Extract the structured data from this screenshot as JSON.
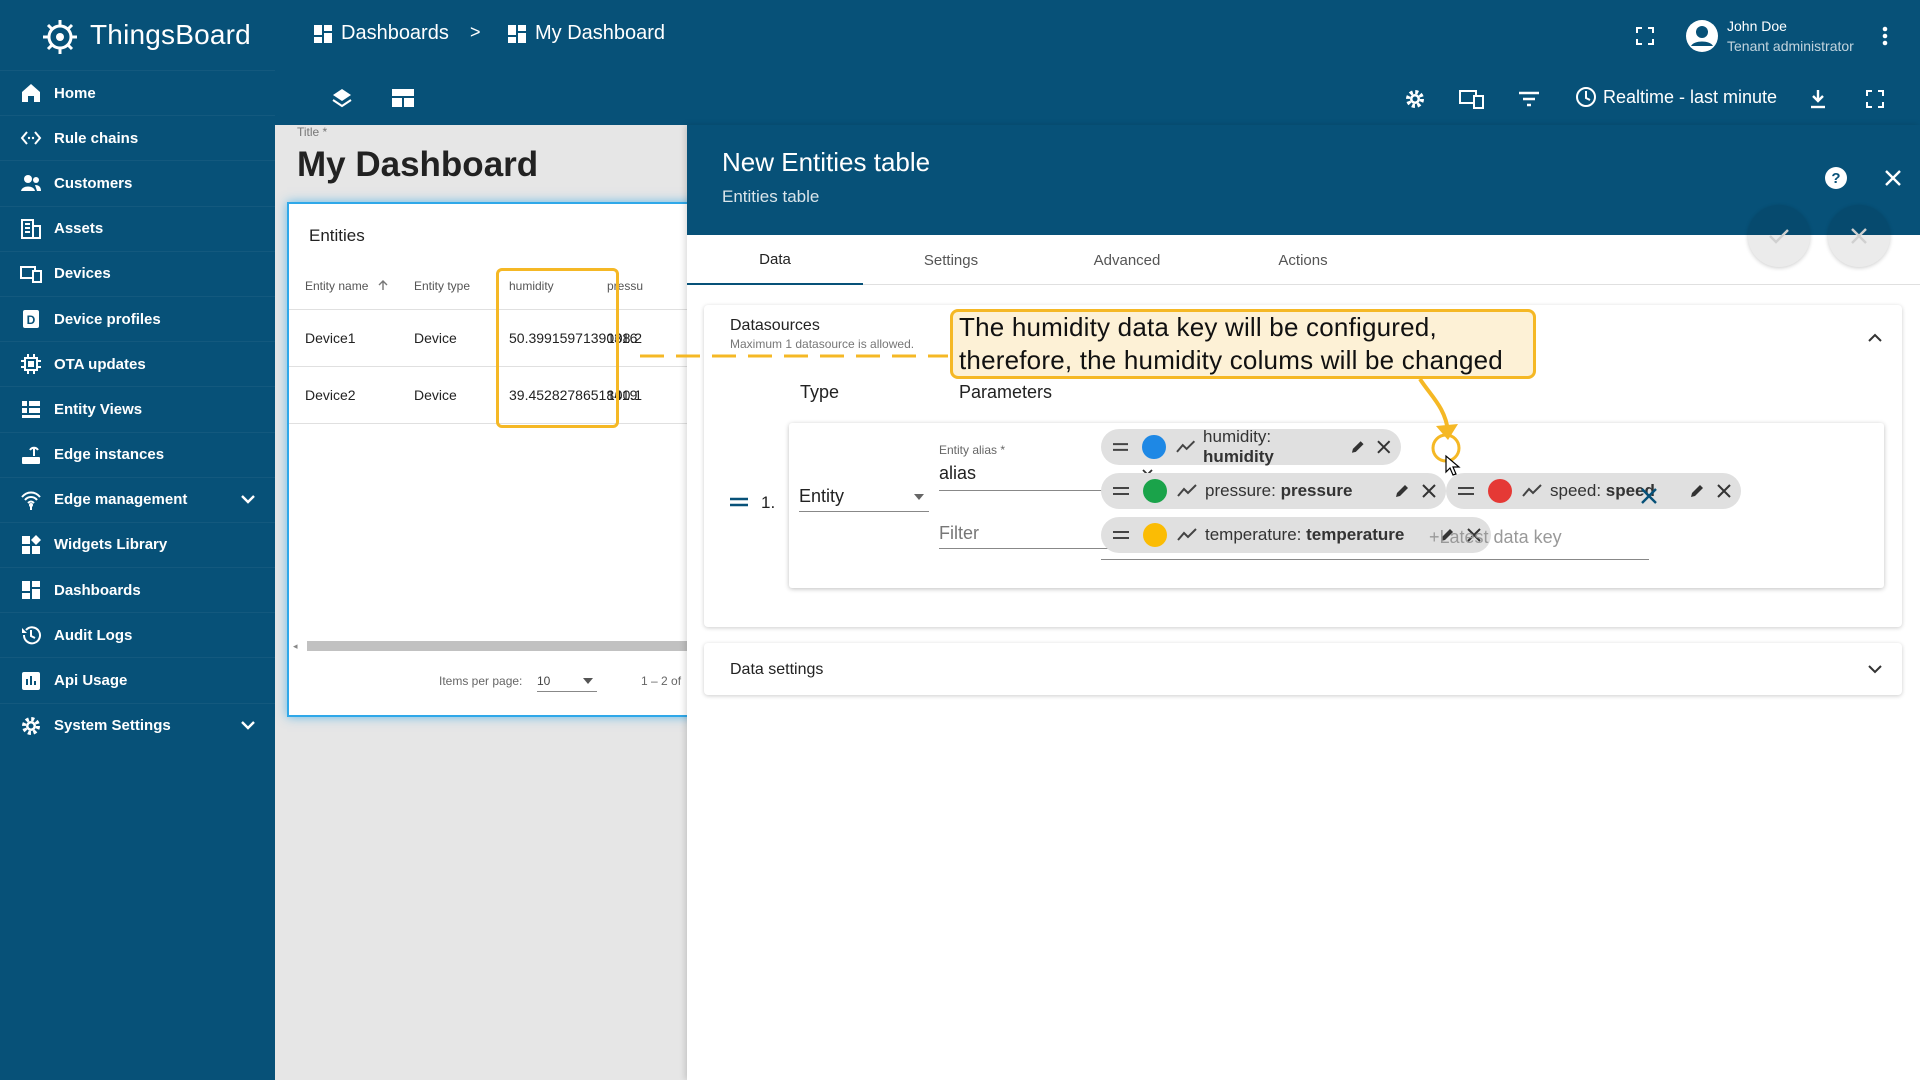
{
  "app": {
    "name": "ThingsBoard"
  },
  "sidebar": {
    "items": [
      {
        "label": "Home",
        "icon": "home-icon"
      },
      {
        "label": "Rule chains",
        "icon": "code-icon"
      },
      {
        "label": "Customers",
        "icon": "people-icon"
      },
      {
        "label": "Assets",
        "icon": "building-icon"
      },
      {
        "label": "Devices",
        "icon": "devices-icon"
      },
      {
        "label": "Device profiles",
        "icon": "profile-icon"
      },
      {
        "label": "OTA updates",
        "icon": "chip-icon"
      },
      {
        "label": "Entity Views",
        "icon": "view-list-icon"
      },
      {
        "label": "Edge instances",
        "icon": "router-icon"
      },
      {
        "label": "Edge management",
        "icon": "wifi-icon"
      },
      {
        "label": "Widgets Library",
        "icon": "widgets-icon"
      },
      {
        "label": "Dashboards",
        "icon": "dashboard-icon"
      },
      {
        "label": "Audit Logs",
        "icon": "history-icon"
      },
      {
        "label": "Api Usage",
        "icon": "chart-icon"
      },
      {
        "label": "System Settings",
        "icon": "gear-icon"
      }
    ]
  },
  "topbar": {
    "breadcrumb_root": "Dashboards",
    "breadcrumb_sep": ">",
    "breadcrumb_current": "My Dashboard",
    "user_name": "John Doe",
    "user_role": "Tenant administrator",
    "timewindow": "Realtime - last minute"
  },
  "dashboard": {
    "title_label": "Title *",
    "title": "My Dashboard",
    "widget": {
      "title": "Entities",
      "columns": [
        "Entity name",
        "Entity type",
        "humidity",
        "pressu"
      ],
      "rows": [
        {
          "name": "Device1",
          "type": "Device",
          "humidity": "50.39915971390316",
          "pressure": "108.2"
        },
        {
          "name": "Device2",
          "type": "Device",
          "humidity": "39.45282786518419",
          "pressure": "100.1"
        }
      ],
      "items_per_page_label": "Items per page:",
      "items_per_page": "10",
      "range": "1 – 2 of"
    }
  },
  "panel": {
    "title": "New Entities table",
    "subtitle": "Entities table",
    "tabs": [
      "Data",
      "Settings",
      "Advanced",
      "Actions"
    ],
    "datasources": {
      "title": "Datasources",
      "hint": "Maximum 1 datasource is allowed.",
      "col_type": "Type",
      "col_params": "Parameters",
      "index": "1.",
      "type_value": "Entity",
      "alias_label": "Entity alias *",
      "alias_value": "alias",
      "filter_placeholder": "Filter",
      "keys": [
        {
          "label": "humidity: ",
          "bold": "humidity",
          "color": "#1e88e5"
        },
        {
          "label": "pressure: ",
          "bold": "pressure",
          "color": "#1aa34a"
        },
        {
          "label": "speed: ",
          "bold": "speed",
          "color": "#e53935"
        },
        {
          "label": "temperature: ",
          "bold": "temperature",
          "color": "#fbbc04"
        }
      ],
      "add_key_placeholder": "+Latest data key"
    },
    "data_settings": "Data settings"
  },
  "annotation": {
    "line1": "The humidity data key will be configured,",
    "line2": "therefore, the humidity colums will be changed",
    "color": "#f5b825"
  }
}
